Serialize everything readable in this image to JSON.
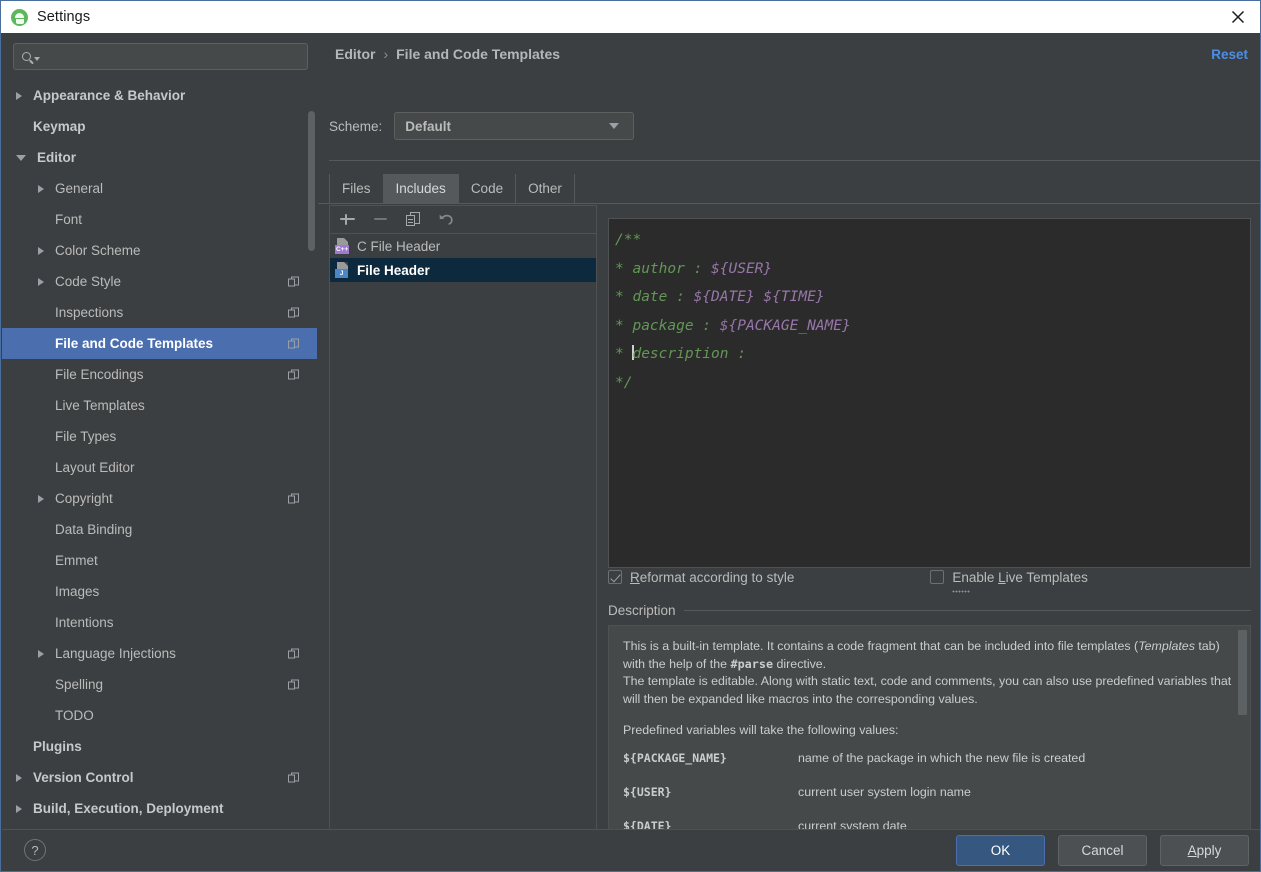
{
  "window": {
    "title": "Settings",
    "app_icon": "android-studio-icon",
    "close_icon": "close-icon"
  },
  "sidebar": {
    "search": {
      "placeholder": "",
      "value": "",
      "icon": "search-icon"
    },
    "items": [
      {
        "label": "Appearance & Behavior",
        "depth": 0,
        "arrow": "right",
        "bold": true,
        "copyable": false,
        "selected": false
      },
      {
        "label": "Keymap",
        "depth": 0,
        "arrow": "none",
        "bold": true,
        "copyable": false,
        "selected": false
      },
      {
        "label": "Editor",
        "depth": 0,
        "arrow": "down",
        "bold": true,
        "copyable": false,
        "selected": false
      },
      {
        "label": "General",
        "depth": 1,
        "arrow": "right",
        "bold": false,
        "copyable": false,
        "selected": false
      },
      {
        "label": "Font",
        "depth": 1,
        "arrow": "none",
        "bold": false,
        "copyable": false,
        "selected": false
      },
      {
        "label": "Color Scheme",
        "depth": 1,
        "arrow": "right",
        "bold": false,
        "copyable": false,
        "selected": false
      },
      {
        "label": "Code Style",
        "depth": 1,
        "arrow": "right",
        "bold": false,
        "copyable": true,
        "selected": false
      },
      {
        "label": "Inspections",
        "depth": 1,
        "arrow": "none",
        "bold": false,
        "copyable": true,
        "selected": false
      },
      {
        "label": "File and Code Templates",
        "depth": 1,
        "arrow": "none",
        "bold": false,
        "copyable": true,
        "selected": true
      },
      {
        "label": "File Encodings",
        "depth": 1,
        "arrow": "none",
        "bold": false,
        "copyable": true,
        "selected": false
      },
      {
        "label": "Live Templates",
        "depth": 1,
        "arrow": "none",
        "bold": false,
        "copyable": false,
        "selected": false
      },
      {
        "label": "File Types",
        "depth": 1,
        "arrow": "none",
        "bold": false,
        "copyable": false,
        "selected": false
      },
      {
        "label": "Layout Editor",
        "depth": 1,
        "arrow": "none",
        "bold": false,
        "copyable": false,
        "selected": false
      },
      {
        "label": "Copyright",
        "depth": 1,
        "arrow": "right",
        "bold": false,
        "copyable": true,
        "selected": false
      },
      {
        "label": "Data Binding",
        "depth": 1,
        "arrow": "none",
        "bold": false,
        "copyable": false,
        "selected": false
      },
      {
        "label": "Emmet",
        "depth": 1,
        "arrow": "none",
        "bold": false,
        "copyable": false,
        "selected": false
      },
      {
        "label": "Images",
        "depth": 1,
        "arrow": "none",
        "bold": false,
        "copyable": false,
        "selected": false
      },
      {
        "label": "Intentions",
        "depth": 1,
        "arrow": "none",
        "bold": false,
        "copyable": false,
        "selected": false
      },
      {
        "label": "Language Injections",
        "depth": 1,
        "arrow": "right",
        "bold": false,
        "copyable": true,
        "selected": false
      },
      {
        "label": "Spelling",
        "depth": 1,
        "arrow": "none",
        "bold": false,
        "copyable": true,
        "selected": false
      },
      {
        "label": "TODO",
        "depth": 1,
        "arrow": "none",
        "bold": false,
        "copyable": false,
        "selected": false
      },
      {
        "label": "Plugins",
        "depth": 0,
        "arrow": "none",
        "bold": true,
        "copyable": false,
        "selected": false
      },
      {
        "label": "Version Control",
        "depth": 0,
        "arrow": "right",
        "bold": true,
        "copyable": true,
        "selected": false
      },
      {
        "label": "Build, Execution, Deployment",
        "depth": 0,
        "arrow": "right",
        "bold": true,
        "copyable": false,
        "selected": false
      }
    ]
  },
  "header": {
    "breadcrumb": {
      "parent": "Editor",
      "separator": "›",
      "current": "File and Code Templates"
    },
    "reset_label": "Reset",
    "scheme_label": "Scheme:",
    "scheme_value": "Default"
  },
  "tabs": [
    {
      "label": "Files",
      "active": false
    },
    {
      "label": "Includes",
      "active": true
    },
    {
      "label": "Code",
      "active": false
    },
    {
      "label": "Other",
      "active": false
    }
  ],
  "list_panel": {
    "toolbar": [
      {
        "name": "add-template-button",
        "icon": "plus-icon",
        "enabled": true
      },
      {
        "name": "remove-template-button",
        "icon": "minus-icon",
        "enabled": false
      },
      {
        "name": "copy-template-button",
        "icon": "copy-icon",
        "enabled": true
      },
      {
        "name": "reset-template-button",
        "icon": "undo-icon",
        "enabled": true
      }
    ],
    "items": [
      {
        "label": "C File Header",
        "badge": "C++",
        "badge_color": "#9e7bd0",
        "selected": false
      },
      {
        "label": "File Header",
        "badge": "J",
        "badge_color": "#4a86c8",
        "selected": true
      }
    ]
  },
  "editor": {
    "lines": [
      [
        {
          "t": "/**",
          "k": "c"
        }
      ],
      [
        {
          "t": "* author : ",
          "k": "c"
        },
        {
          "t": "${USER}",
          "k": "v"
        }
      ],
      [
        {
          "t": "* date : ",
          "k": "c"
        },
        {
          "t": "${DATE}",
          "k": "v"
        },
        {
          "t": " ",
          "k": "c"
        },
        {
          "t": "${TIME}",
          "k": "v"
        }
      ],
      [
        {
          "t": "* package : ",
          "k": "c"
        },
        {
          "t": "${PACKAGE_NAME}",
          "k": "v"
        }
      ],
      [
        {
          "t": "* ",
          "k": "c"
        },
        {
          "t": "|",
          "k": "caret"
        },
        {
          "t": "description : ",
          "k": "c"
        }
      ],
      [
        {
          "t": "*/",
          "k": "c"
        }
      ]
    ],
    "comment_color": "#629755",
    "variable_color": "#9876aa",
    "background": "#2b2b2b"
  },
  "options": {
    "reformat": {
      "label_pre": "",
      "mnemonic": "R",
      "label_post": "eformat according to style",
      "checked": true
    },
    "live_templates": {
      "label_pre": "Enable ",
      "mnemonic": "L",
      "label_post": "ive Templates",
      "checked": false,
      "focused": true
    }
  },
  "description": {
    "title": "Description",
    "paragraph1_a": "This is a built-in template. It contains a code fragment that can be included into file templates (",
    "paragraph1_italic": "Templates",
    "paragraph1_b": " tab) with the help of the ",
    "paragraph1_mono": "#parse",
    "paragraph1_c": " directive.",
    "paragraph2": "The template is editable. Along with static text, code and comments, you can also use predefined variables that will then be expanded like macros into the corresponding values.",
    "paragraph3": "Predefined variables will take the following values:",
    "variables": [
      {
        "name": "${PACKAGE_NAME}",
        "desc": "name of the package in which the new file is created"
      },
      {
        "name": "${USER}",
        "desc": "current user system login name"
      },
      {
        "name": "${DATE}",
        "desc": "current system date"
      }
    ]
  },
  "footer": {
    "help_label": "?",
    "buttons": [
      {
        "label": "OK",
        "primary": true,
        "mnemonic": ""
      },
      {
        "label": "Cancel",
        "primary": false,
        "mnemonic": ""
      },
      {
        "label": "Apply",
        "primary": false,
        "mnemonic": "A"
      }
    ]
  },
  "colors": {
    "window_bg": "#3c3f41",
    "selection_blue": "#4b6eaf",
    "list_selection": "#0d293e",
    "link_blue": "#4b8ee8",
    "primary_button": "#365880"
  }
}
